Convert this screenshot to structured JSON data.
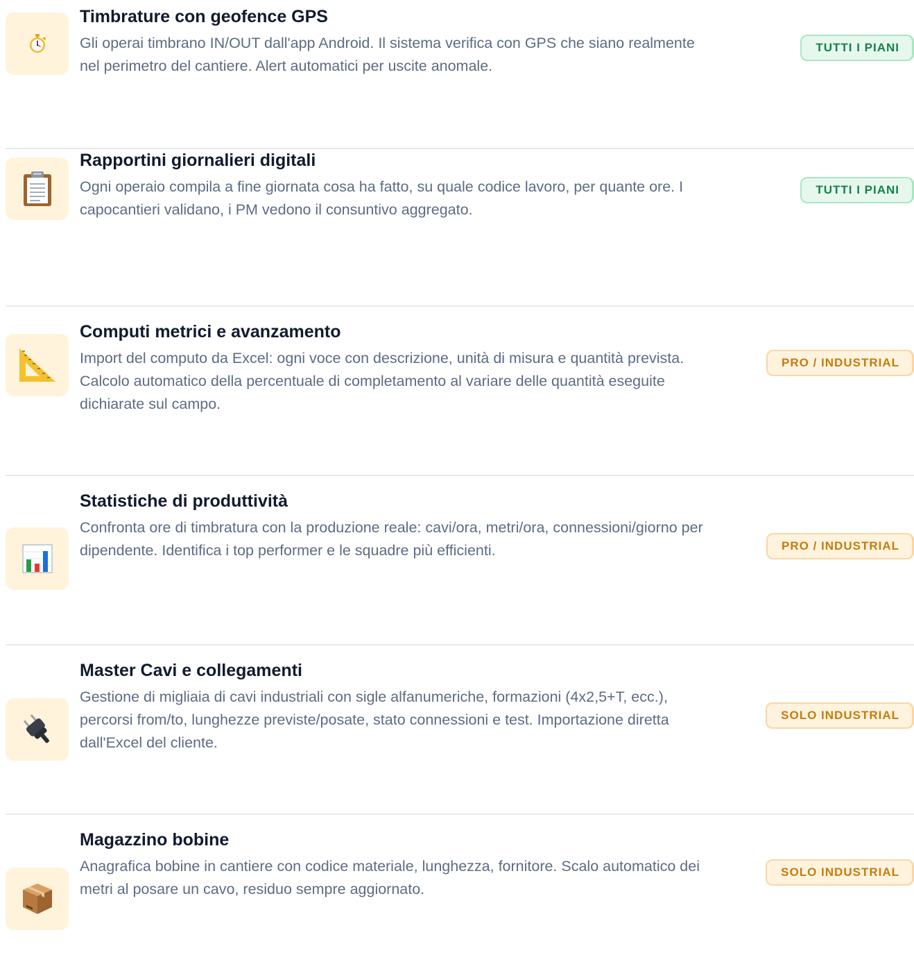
{
  "features": [
    {
      "icon": "stopwatch-icon",
      "title": "Timbrature con geofence GPS",
      "description": "Gli operai timbrano IN/OUT dall'app Android. Il sistema verifica con GPS che siano realmente nel perimetro del cantiere. Alert automatici per uscite anomale.",
      "badge": "TUTTI I PIANI",
      "badge_variant": "green"
    },
    {
      "icon": "clipboard-icon",
      "title": "Rapportini giornalieri digitali",
      "description": "Ogni operaio compila a fine giornata cosa ha fatto, su quale codice lavoro, per quante ore. I capocantieri validano, i PM vedono il consuntivo aggregato.",
      "badge": "TUTTI I PIANI",
      "badge_variant": "green"
    },
    {
      "icon": "triangular-ruler-icon",
      "title": "Computi metrici e avanzamento",
      "description": "Import del computo da Excel: ogni voce con descrizione, unità di misura e quantità prevista. Calcolo automatico della percentuale di completamento al variare delle quantità eseguite dichiarate sul campo.",
      "badge": "PRO / INDUSTRIAL",
      "badge_variant": "amber"
    },
    {
      "icon": "bar-chart-icon",
      "title": "Statistiche di produttività",
      "description": "Confronta ore di timbratura con la produzione reale: cavi/ora, metri/ora, connessioni/giorno per dipendente. Identifica i top performer e le squadre più efficienti.",
      "badge": "PRO / INDUSTRIAL",
      "badge_variant": "amber"
    },
    {
      "icon": "electric-plug-icon",
      "title": "Master Cavi e collegamenti",
      "description": "Gestione di migliaia di cavi industriali con sigle alfanumeriche, formazioni (4x2,5+T, ecc.), percorsi from/to, lunghezze previste/posate, stato connessioni e test. Importazione diretta dall'Excel del cliente.",
      "badge": "SOLO INDUSTRIAL",
      "badge_variant": "amber"
    },
    {
      "icon": "package-icon",
      "title": "Magazzino bobine",
      "description": "Anagrafica bobine in cantiere con codice materiale, lunghezza, fornitore. Scalo automatico dei metri al posare un cavo, residuo sempre aggiornato.",
      "badge": "SOLO INDUSTRIAL",
      "badge_variant": "amber"
    }
  ],
  "colors": {
    "title": "#111a2e",
    "description": "#5d6b82",
    "icon_bg": "#fff3dc",
    "badge_green_text": "#15804a",
    "badge_amber_text": "#c57b0c",
    "divider": "#e6e9ee"
  }
}
